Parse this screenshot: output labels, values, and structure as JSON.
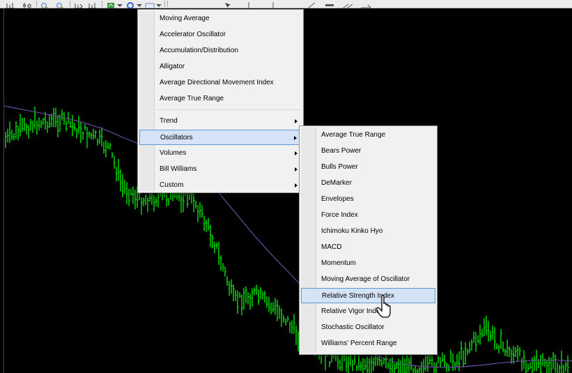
{
  "toolbar": {
    "buttons": [
      "chart-bar-icon",
      "chart-candle-icon",
      "zoom-in-icon",
      "zoom-out-icon",
      "tile-icon",
      "autoscroll-icon",
      "indicators-icon",
      "periods-icon",
      "templates-icon",
      "crosshair-icon",
      "vertical-line-icon",
      "horizontal-line-icon",
      "trendline-icon",
      "equidistant-channel-icon",
      "fibonacci-icon",
      "text-icon"
    ]
  },
  "colors": {
    "chart_background": "#000000",
    "candles": "#00e400",
    "moving_average": "#6a4aa0",
    "menu_background": "#f1f1f1",
    "menu_highlight": "#d4e4f6",
    "menu_highlight_border": "#5f98d3"
  },
  "main_menu": {
    "items": [
      {
        "label": "Moving Average",
        "submenu": false
      },
      {
        "label": "Accelerator Oscillator",
        "submenu": false
      },
      {
        "label": "Accumulation/Distribution",
        "submenu": false
      },
      {
        "label": "Alligator",
        "submenu": false
      },
      {
        "label": "Average Directional Movement Index",
        "submenu": false
      },
      {
        "label": "Average True Range",
        "submenu": false
      },
      {
        "label": "Trend",
        "submenu": true
      },
      {
        "label": "Oscillators",
        "submenu": true,
        "highlighted": true
      },
      {
        "label": "Volumes",
        "submenu": true
      },
      {
        "label": "Bill Williams",
        "submenu": true
      },
      {
        "label": "Custom",
        "submenu": true
      }
    ]
  },
  "oscillators_menu": {
    "items": [
      {
        "label": "Average True Range"
      },
      {
        "label": "Bears Power"
      },
      {
        "label": "Bulls Power"
      },
      {
        "label": "DeMarker"
      },
      {
        "label": "Envelopes"
      },
      {
        "label": "Force Index"
      },
      {
        "label": "Ichimoku Kinko Hyo"
      },
      {
        "label": "MACD"
      },
      {
        "label": "Momentum"
      },
      {
        "label": "Moving Average of Oscillator"
      },
      {
        "label": "Relative Strength Index",
        "highlighted": true
      },
      {
        "label": "Relative Vigor Index"
      },
      {
        "label": "Stochastic Oscillator"
      },
      {
        "label": "Williams' Percent Range"
      }
    ]
  }
}
